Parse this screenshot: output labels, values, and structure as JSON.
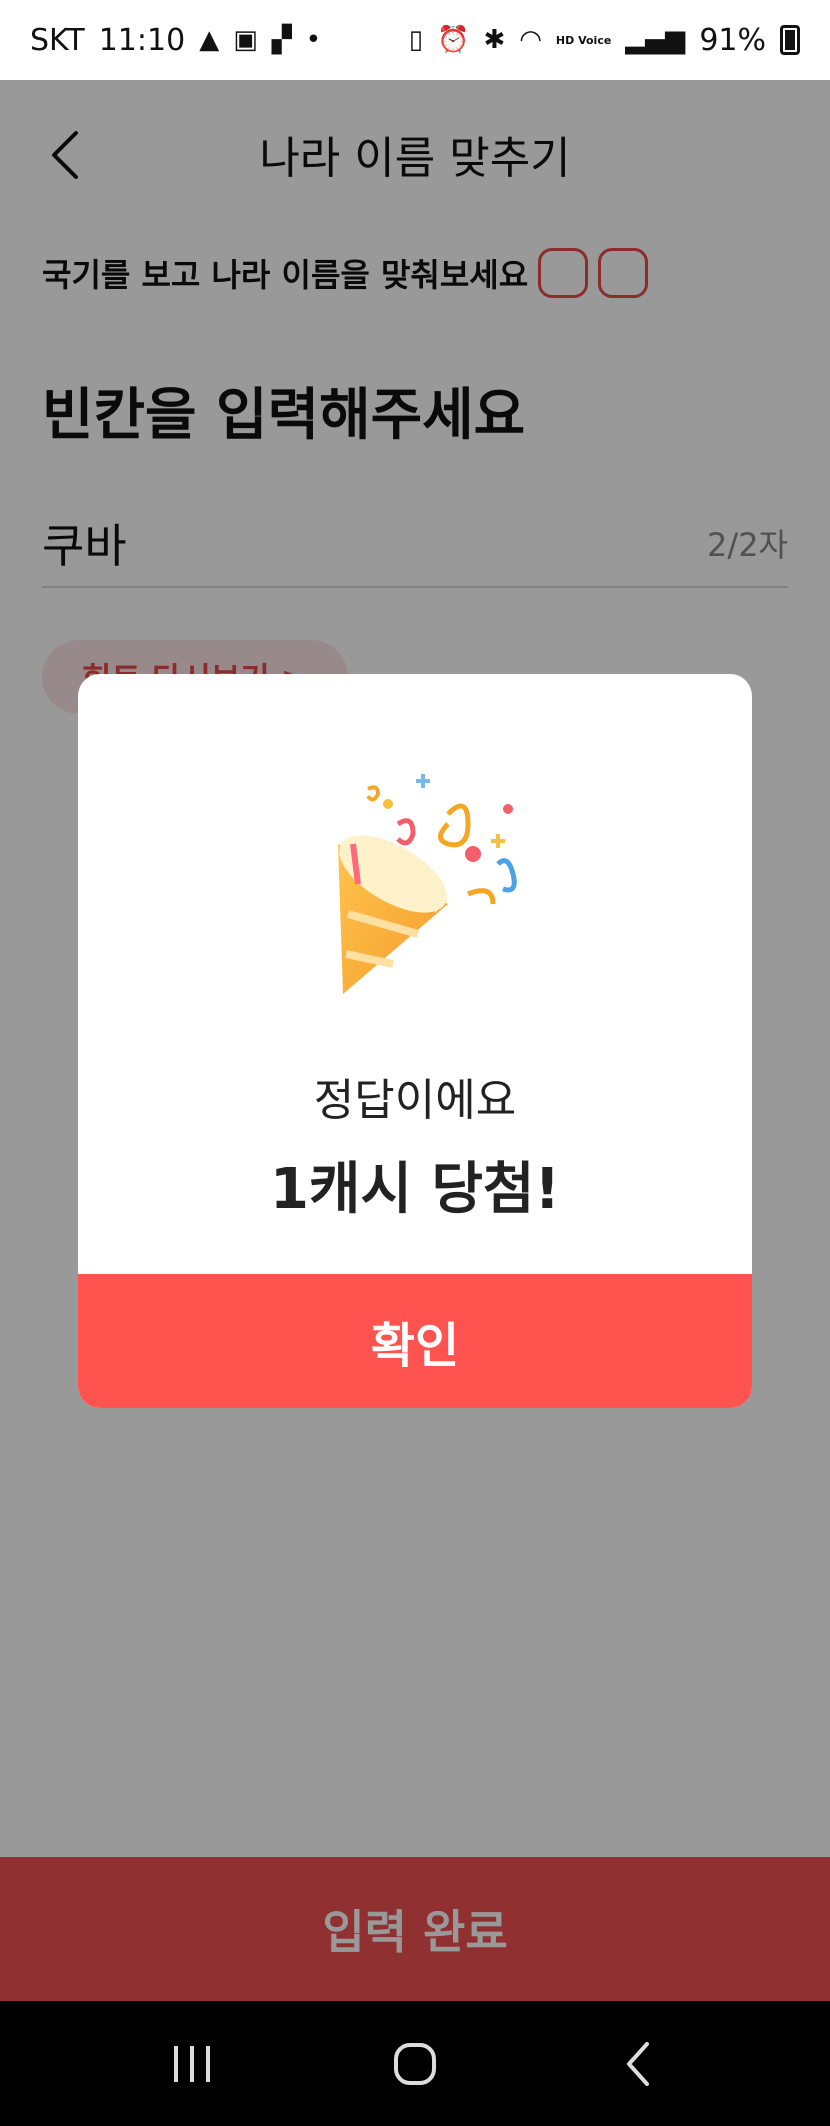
{
  "status_bar": {
    "carrier": "SKT",
    "time": "11:10",
    "battery": "91%",
    "hd_voice": "HD Voice"
  },
  "header": {
    "title": "나라 이름 맞추기",
    "back_icon": "chevron-left-icon"
  },
  "instruction": "국기를 보고 나라 이름을 맞춰보세요",
  "heading": "빈칸을 입력해주세요",
  "answer": {
    "value": "쿠바",
    "count": "2/2자"
  },
  "hint_button": "힌트 다시보기 >",
  "submit_button": "입력 완료",
  "dialog": {
    "subtitle": "정답이에요",
    "title": "1캐시 당첨!",
    "confirm_label": "확인",
    "image": "party-popper-icon"
  },
  "nav_bar": {
    "recent_icon": "recent-apps-icon",
    "home_icon": "home-icon",
    "back_icon": "back-icon"
  },
  "colors": {
    "accent": "#ff5350",
    "submit": "#f05050",
    "overlay": "rgba(0,0,0,0.4)"
  }
}
